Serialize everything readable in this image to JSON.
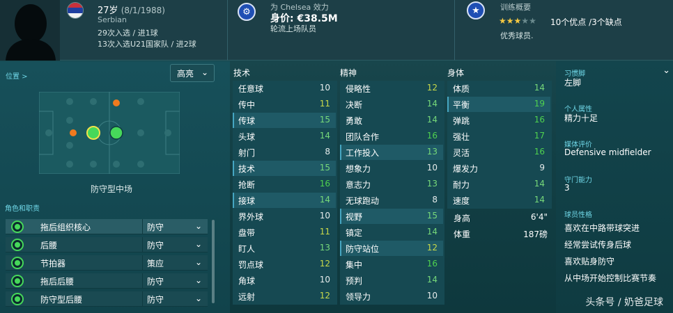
{
  "header": {
    "age": "27岁",
    "dob": "(8/1/1988)",
    "nationality": "Serbian",
    "caps": "29次入选 / 进1球",
    "u21": "13次入选U21国家队 / 进2球",
    "club_line": "为 Chelsea 效力",
    "value": "身价: €38.5M",
    "squad_status": "轮流上场队员",
    "training_title": "训练概要",
    "training_stars": 3,
    "training_stars_max": 5,
    "pros_cons": "10个优点 /3个缺点",
    "grade": "优秀球员."
  },
  "left": {
    "position_label": "位置 >",
    "dropdown_value": "高亮",
    "role_title": "防守型中场",
    "roles_label": "角色和职责",
    "roles": [
      {
        "name": "拖后组织核心",
        "duty": "防守"
      },
      {
        "name": "后腰",
        "duty": "防守"
      },
      {
        "name": "节拍器",
        "duty": "策应"
      },
      {
        "name": "拖后后腰",
        "duty": "防守"
      },
      {
        "name": "防守型后腰",
        "duty": "防守"
      }
    ]
  },
  "attributes": {
    "technical_title": "技术",
    "mental_title": "精神",
    "physical_title": "身体",
    "technical": [
      {
        "name": "任意球",
        "value": "10"
      },
      {
        "name": "传中",
        "value": "11"
      },
      {
        "name": "传球",
        "value": "15"
      },
      {
        "name": "头球",
        "value": "14"
      },
      {
        "name": "射门",
        "value": "8"
      },
      {
        "name": "技术",
        "value": "15"
      },
      {
        "name": "抢断",
        "value": "16"
      },
      {
        "name": "接球",
        "value": "14"
      },
      {
        "name": "界外球",
        "value": "10"
      },
      {
        "name": "盘带",
        "value": "11"
      },
      {
        "name": "盯人",
        "value": "13"
      },
      {
        "name": "罚点球",
        "value": "12"
      },
      {
        "name": "角球",
        "value": "10"
      },
      {
        "name": "远射",
        "value": "12"
      }
    ],
    "mental": [
      {
        "name": "侵略性",
        "value": "12"
      },
      {
        "name": "决断",
        "value": "14"
      },
      {
        "name": "勇敢",
        "value": "14"
      },
      {
        "name": "团队合作",
        "value": "16"
      },
      {
        "name": "工作投入",
        "value": "13"
      },
      {
        "name": "想象力",
        "value": "10"
      },
      {
        "name": "意志力",
        "value": "13"
      },
      {
        "name": "无球跑动",
        "value": "8"
      },
      {
        "name": "视野",
        "value": "15"
      },
      {
        "name": "镇定",
        "value": "14"
      },
      {
        "name": "防守站位",
        "value": "12"
      },
      {
        "name": "集中",
        "value": "16"
      },
      {
        "name": "预判",
        "value": "14"
      },
      {
        "name": "领导力",
        "value": "10"
      }
    ],
    "physical": [
      {
        "name": "体质",
        "value": "14"
      },
      {
        "name": "平衡",
        "value": "19"
      },
      {
        "name": "弹跳",
        "value": "16"
      },
      {
        "name": "强壮",
        "value": "17"
      },
      {
        "name": "灵活",
        "value": "16"
      },
      {
        "name": "爆发力",
        "value": "9"
      },
      {
        "name": "耐力",
        "value": "14"
      },
      {
        "name": "速度",
        "value": "14"
      }
    ],
    "height_label": "身高",
    "height": "6'4\"",
    "weight_label": "体重",
    "weight": "187磅"
  },
  "right": {
    "foot_label": "习惯脚",
    "foot": "左脚",
    "personality_label": "个人属性",
    "personality": "精力十足",
    "media_label": "媒体评价",
    "media": "Defensive midfielder",
    "defense_label": "守门能力",
    "defense": "3",
    "traits_label": "球员性格",
    "traits": [
      "喜欢在中路带球突进",
      "经常尝试传身后球",
      "喜欢贴身防守",
      "从中场开始控制比赛节奏"
    ]
  },
  "watermark": "头条号 / 奶爸足球",
  "colors": {
    "accent": "#6fd6e6",
    "green": "#46d85a",
    "orange": "#f07a1e",
    "highlight_row": "#1f5a66"
  }
}
